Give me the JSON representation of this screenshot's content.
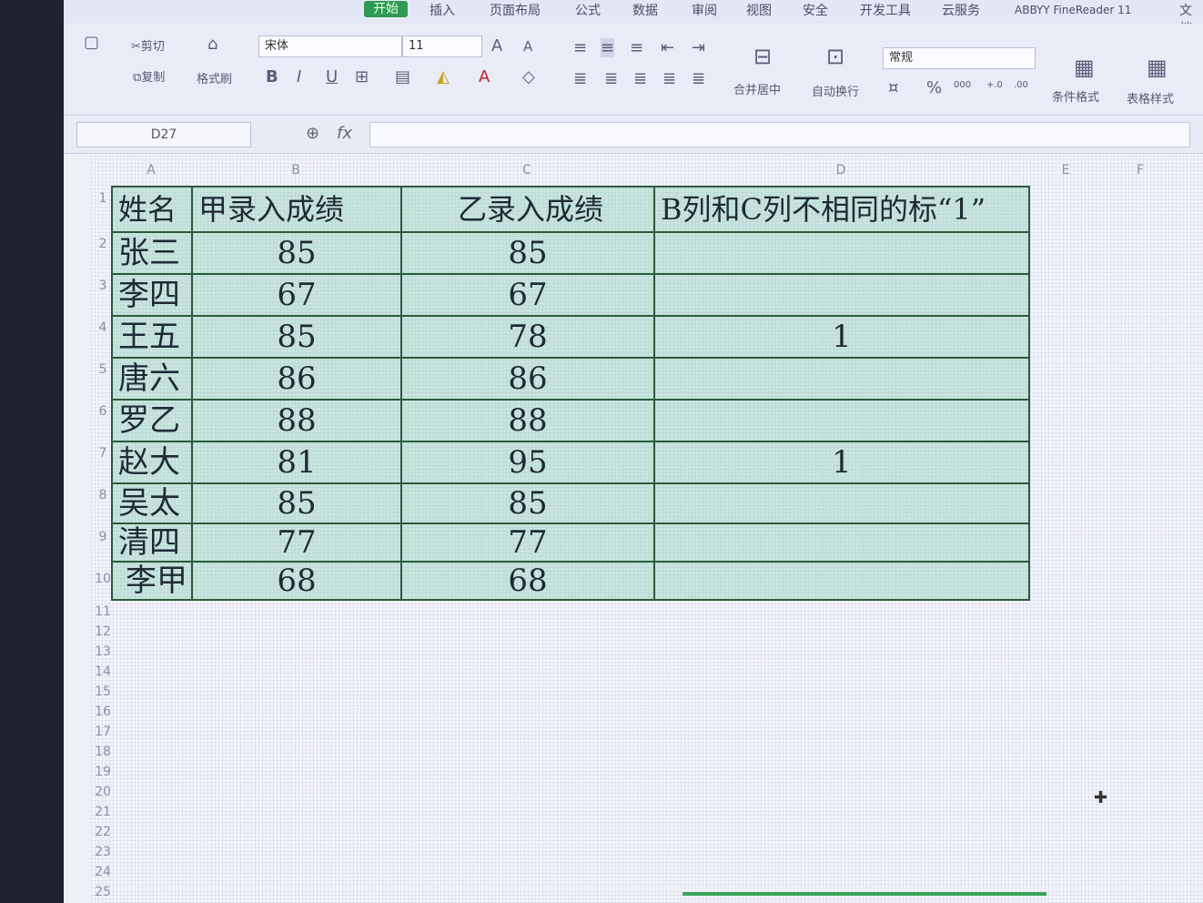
{
  "ribbon": {
    "tabs": [
      "开始",
      "插入",
      "页面布局",
      "公式",
      "数据",
      "审阅",
      "视图",
      "安全",
      "开发工具",
      "云服务",
      "ABBYY FineReader 11",
      "文档"
    ],
    "active_tab": "开始",
    "cut_label": "剪切",
    "copy_label": "复制",
    "format_painter_label": "格式刷",
    "font_name": "宋体",
    "font_size": "11",
    "bold": "B",
    "italic": "I",
    "underline": "U",
    "merge_label": "合并居中",
    "wrap_label": "自动换行",
    "number_format": "常规",
    "percent": "%",
    "thousands": "000",
    "cond_format_label": "条件格式",
    "table_style_label": "表格样式"
  },
  "formula_bar": {
    "name_box": "D27",
    "fx": "fx",
    "formula": ""
  },
  "grid": {
    "columns": [
      "A",
      "B",
      "C",
      "D",
      "E",
      "F"
    ],
    "row_numbers": [
      "1",
      "2",
      "3",
      "4",
      "5",
      "6",
      "7",
      "8",
      "9",
      "10",
      "11",
      "12",
      "13",
      "14",
      "15",
      "16",
      "17",
      "18",
      "19",
      "20",
      "21",
      "22",
      "23",
      "24",
      "25"
    ],
    "header": [
      "姓名",
      "甲录入成绩",
      "乙录入成绩",
      "B列和C列不相同的标“1”"
    ],
    "rows": [
      [
        "张三",
        "85",
        "85",
        ""
      ],
      [
        "李四",
        "67",
        "67",
        ""
      ],
      [
        "王五",
        "85",
        "78",
        "1"
      ],
      [
        "唐六",
        "86",
        "86",
        ""
      ],
      [
        "罗乙",
        "88",
        "88",
        ""
      ],
      [
        "赵大",
        "81",
        "95",
        "1"
      ],
      [
        "吴太",
        "85",
        "85",
        ""
      ],
      [
        "清四",
        "77",
        "77",
        ""
      ],
      [
        "李甲",
        "68",
        "68",
        ""
      ]
    ]
  },
  "colors": {
    "accent": "#2f9a52",
    "cell_fill": "#a8dcc6",
    "border": "#2b5a3c"
  }
}
